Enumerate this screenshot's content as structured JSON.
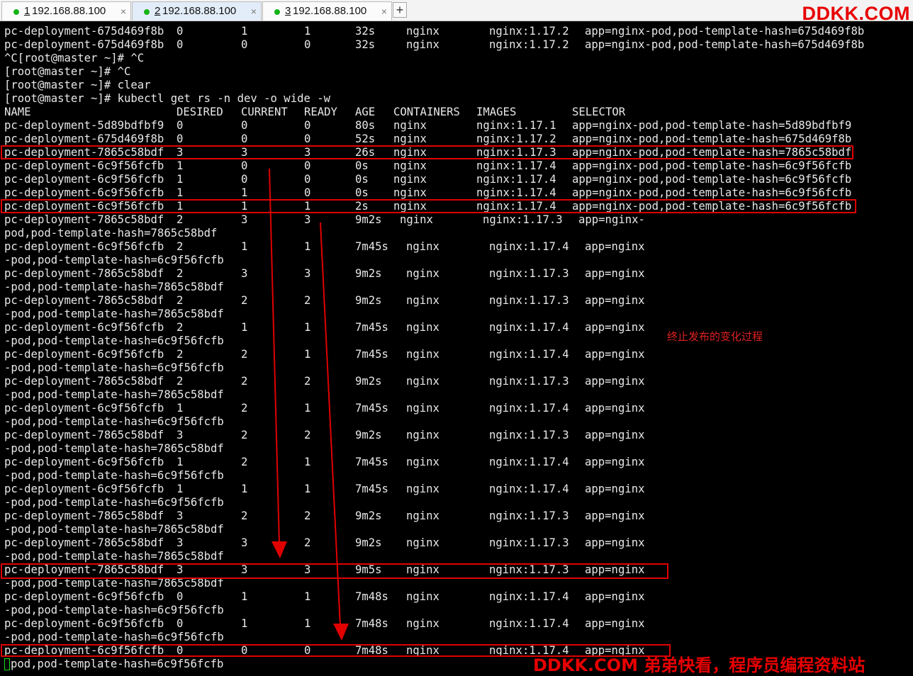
{
  "tabs": [
    {
      "status": "connected",
      "number": "1",
      "host": "192.168.88.100",
      "close": "×",
      "active": false
    },
    {
      "status": "connected",
      "number": "2",
      "host": "192.168.88.100",
      "close": "×",
      "active": true
    },
    {
      "status": "connected",
      "number": "3",
      "host": "192.168.88.100",
      "close": "×",
      "active": false
    }
  ],
  "new_tab_label": "+",
  "brand_top": "DDKK.COM",
  "brand_bottom": "DDKK.COM 弟弟快看，程序员编程资料站",
  "annotation": "终止发布的变化过程",
  "colors": {
    "accent": "#e00000",
    "terminal_bg": "#000000",
    "terminal_fg": "#e8e8e8",
    "status_dot": "#16b316"
  },
  "terminal": {
    "lines": [
      {
        "cells": [
          "pc-deployment-675d469f8b",
          "0",
          "1",
          "1",
          "32s",
          "nginx",
          "nginx:1.17.2",
          "app=nginx-pod,pod-template-hash=675d469f8b"
        ]
      },
      {
        "cells": [
          "pc-deployment-675d469f8b",
          "0",
          "0",
          "0",
          "32s",
          "nginx",
          "nginx:1.17.2",
          "app=nginx-pod,pod-template-hash=675d469f8b"
        ]
      },
      {
        "text": "^C[root@master ~]# ^C"
      },
      {
        "text": "[root@master ~]# ^C"
      },
      {
        "text": "[root@master ~]# clear"
      },
      {
        "text": "[root@master ~]# kubectl get rs -n dev -o wide -w"
      },
      {
        "cells": [
          "NAME",
          "DESIRED",
          "CURRENT",
          "READY",
          "AGE",
          "CONTAINERS",
          "IMAGES",
          "SELECTOR"
        ]
      },
      {
        "cells": [
          "pc-deployment-5d89bdfbf9",
          "0",
          "0",
          "0",
          "80s",
          "nginx",
          "nginx:1.17.1",
          "app=nginx-pod,pod-template-hash=5d89bdfbf9"
        ]
      },
      {
        "cells": [
          "pc-deployment-675d469f8b",
          "0",
          "0",
          "0",
          "52s",
          "nginx",
          "nginx:1.17.2",
          "app=nginx-pod,pod-template-hash=675d469f8b"
        ]
      },
      {
        "cells": [
          "pc-deployment-7865c58bdf",
          "3",
          "3",
          "3",
          "26s",
          "nginx",
          "nginx:1.17.3",
          "app=nginx-pod,pod-template-hash=7865c58bdf"
        ]
      },
      {
        "cells": [
          "pc-deployment-6c9f56fcfb",
          "1",
          "0",
          "0",
          "0s",
          "nginx",
          "nginx:1.17.4",
          "app=nginx-pod,pod-template-hash=6c9f56fcfb"
        ]
      },
      {
        "cells": [
          "pc-deployment-6c9f56fcfb",
          "1",
          "0",
          "0",
          "0s",
          "nginx",
          "nginx:1.17.4",
          "app=nginx-pod,pod-template-hash=6c9f56fcfb"
        ]
      },
      {
        "cells": [
          "pc-deployment-6c9f56fcfb",
          "1",
          "1",
          "0",
          "0s",
          "nginx",
          "nginx:1.17.4",
          "app=nginx-pod,pod-template-hash=6c9f56fcfb"
        ]
      },
      {
        "cells": [
          "pc-deployment-6c9f56fcfb",
          "1",
          "1",
          "1",
          "2s",
          "nginx",
          "nginx:1.17.4",
          "app=nginx-pod,pod-template-hash=6c9f56fcfb"
        ]
      },
      {
        "cells": [
          "pc-deployment-7865c58bdf",
          "2",
          "3",
          "3",
          "9m2s",
          "nginx",
          "nginx:1.17.3",
          "app=nginx-"
        ]
      },
      {
        "text": "pod,pod-template-hash=7865c58bdf"
      },
      {
        "cells": [
          "pc-deployment-6c9f56fcfb",
          "2",
          "1",
          "1",
          "7m45s",
          "nginx",
          "nginx:1.17.4",
          "app=nginx"
        ]
      },
      {
        "text": "-pod,pod-template-hash=6c9f56fcfb"
      },
      {
        "cells": [
          "pc-deployment-7865c58bdf",
          "2",
          "3",
          "3",
          "9m2s",
          "nginx",
          "nginx:1.17.3",
          "app=nginx"
        ]
      },
      {
        "text": "-pod,pod-template-hash=7865c58bdf"
      },
      {
        "cells": [
          "pc-deployment-7865c58bdf",
          "2",
          "2",
          "2",
          "9m2s",
          "nginx",
          "nginx:1.17.3",
          "app=nginx"
        ]
      },
      {
        "text": "-pod,pod-template-hash=7865c58bdf"
      },
      {
        "cells": [
          "pc-deployment-6c9f56fcfb",
          "2",
          "1",
          "1",
          "7m45s",
          "nginx",
          "nginx:1.17.4",
          "app=nginx"
        ]
      },
      {
        "text": "-pod,pod-template-hash=6c9f56fcfb"
      },
      {
        "cells": [
          "pc-deployment-6c9f56fcfb",
          "2",
          "2",
          "1",
          "7m45s",
          "nginx",
          "nginx:1.17.4",
          "app=nginx"
        ]
      },
      {
        "text": "-pod,pod-template-hash=6c9f56fcfb"
      },
      {
        "cells": [
          "pc-deployment-7865c58bdf",
          "2",
          "2",
          "2",
          "9m2s",
          "nginx",
          "nginx:1.17.3",
          "app=nginx"
        ]
      },
      {
        "text": "-pod,pod-template-hash=7865c58bdf"
      },
      {
        "cells": [
          "pc-deployment-6c9f56fcfb",
          "1",
          "2",
          "1",
          "7m45s",
          "nginx",
          "nginx:1.17.4",
          "app=nginx"
        ]
      },
      {
        "text": "-pod,pod-template-hash=6c9f56fcfb"
      },
      {
        "cells": [
          "pc-deployment-7865c58bdf",
          "3",
          "2",
          "2",
          "9m2s",
          "nginx",
          "nginx:1.17.3",
          "app=nginx"
        ]
      },
      {
        "text": "-pod,pod-template-hash=7865c58bdf"
      },
      {
        "cells": [
          "pc-deployment-6c9f56fcfb",
          "1",
          "2",
          "1",
          "7m45s",
          "nginx",
          "nginx:1.17.4",
          "app=nginx"
        ]
      },
      {
        "text": "-pod,pod-template-hash=6c9f56fcfb"
      },
      {
        "cells": [
          "pc-deployment-6c9f56fcfb",
          "1",
          "1",
          "1",
          "7m45s",
          "nginx",
          "nginx:1.17.4",
          "app=nginx"
        ]
      },
      {
        "text": "-pod,pod-template-hash=6c9f56fcfb"
      },
      {
        "cells": [
          "pc-deployment-7865c58bdf",
          "3",
          "2",
          "2",
          "9m2s",
          "nginx",
          "nginx:1.17.3",
          "app=nginx"
        ]
      },
      {
        "text": "-pod,pod-template-hash=7865c58bdf"
      },
      {
        "cells": [
          "pc-deployment-7865c58bdf",
          "3",
          "3",
          "2",
          "9m2s",
          "nginx",
          "nginx:1.17.3",
          "app=nginx"
        ]
      },
      {
        "text": "-pod,pod-template-hash=7865c58bdf"
      },
      {
        "cells": [
          "pc-deployment-7865c58bdf",
          "3",
          "3",
          "3",
          "9m5s",
          "nginx",
          "nginx:1.17.3",
          "app=nginx"
        ]
      },
      {
        "text": "-pod,pod-template-hash=7865c58bdf"
      },
      {
        "cells": [
          "pc-deployment-6c9f56fcfb",
          "0",
          "1",
          "1",
          "7m48s",
          "nginx",
          "nginx:1.17.4",
          "app=nginx"
        ]
      },
      {
        "text": "-pod,pod-template-hash=6c9f56fcfb"
      },
      {
        "cells": [
          "pc-deployment-6c9f56fcfb",
          "0",
          "1",
          "1",
          "7m48s",
          "nginx",
          "nginx:1.17.4",
          "app=nginx"
        ]
      },
      {
        "text": "-pod,pod-template-hash=6c9f56fcfb"
      },
      {
        "cells": [
          "pc-deployment-6c9f56fcfb",
          "0",
          "0",
          "0",
          "7m48s",
          "nginx",
          "nginx:1.17.4",
          "app=nginx"
        ]
      },
      {
        "text": "pod,pod-template-hash=6c9f56fcfb"
      }
    ]
  }
}
